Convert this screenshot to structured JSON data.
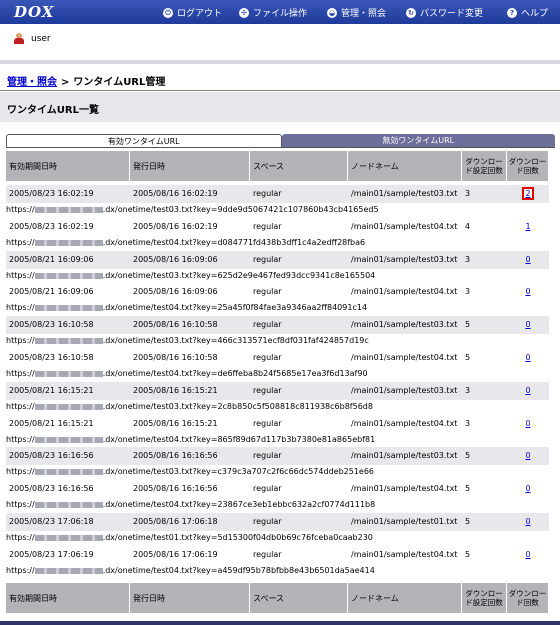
{
  "header": {
    "logo": "DOX",
    "nav": [
      {
        "label": "ログアウト",
        "icon": "logout-icon"
      },
      {
        "label": "ファイル操作",
        "icon": "file-operation-icon"
      },
      {
        "label": "管理・照会",
        "icon": "admin-icon"
      },
      {
        "label": "パスワード変更",
        "icon": "password-change-icon"
      },
      {
        "label": "ヘルプ",
        "icon": "help-icon"
      }
    ]
  },
  "user": {
    "name": "user"
  },
  "breadcrumb": {
    "parent": "管理・照会",
    "separator": ">",
    "current": "ワンタイムURL管理"
  },
  "section_title": "ワンタイムURL一覧",
  "tabs": [
    {
      "label": "有効ワンタイムURL",
      "active": true
    },
    {
      "label": "無効ワンタイムURL",
      "active": false
    }
  ],
  "columns": {
    "expiry": "有効期間日時",
    "issued": "発行日時",
    "space": "スペース",
    "node": "ノードネーム",
    "dl_limit": "ダウンロード設定回数",
    "dl_count": "ダウンロード回数"
  },
  "rows": [
    {
      "expiry": "2005/08/23 16:02:19",
      "issued": "2005/08/16 16:02:19",
      "space": "regular",
      "node": "/main01/sample/test03.txt",
      "limit": "3",
      "count": "2",
      "url_prefix": "https://",
      "url_suffix": ".dx/onetime/test03.txt?key=9dde9d5067421c107860b43cb4165ed5",
      "highlight": true
    },
    {
      "expiry": "2005/08/23 16:02:19",
      "issued": "2005/08/16 16:02:19",
      "space": "regular",
      "node": "/main01/sample/test04.txt",
      "limit": "4",
      "count": "1",
      "url_prefix": "https://",
      "url_suffix": ".dx/onetime/test04.txt?key=d084771fd438b3dff1c4a2edff28fba6"
    },
    {
      "expiry": "2005/08/21 16:09:06",
      "issued": "2005/08/16 16:09:06",
      "space": "regular",
      "node": "/main01/sample/test03.txt",
      "limit": "3",
      "count": "0",
      "url_prefix": "https://",
      "url_suffix": ".dx/onetime/test03.txt?key=625d2e9e467fed93dcc9341c8e165504"
    },
    {
      "expiry": "2005/08/21 16:09:06",
      "issued": "2005/08/16 16:09:06",
      "space": "regular",
      "node": "/main01/sample/test04.txt",
      "limit": "3",
      "count": "0",
      "url_prefix": "https://",
      "url_suffix": ".dx/onetime/test04.txt?key=25a45f0f84fae3a9346aa2ff84091c14"
    },
    {
      "expiry": "2005/08/23 16:10:58",
      "issued": "2005/08/16 16:10:58",
      "space": "regular",
      "node": "/main01/sample/test03.txt",
      "limit": "5",
      "count": "0",
      "url_prefix": "https://",
      "url_suffix": ".dx/onetime/test03.txt?key=466c313571ecf8df031faf424857d19c"
    },
    {
      "expiry": "2005/08/23 16:10:58",
      "issued": "2005/08/16 16:10:58",
      "space": "regular",
      "node": "/main01/sample/test04.txt",
      "limit": "5",
      "count": "0",
      "url_prefix": "https://",
      "url_suffix": ".dx/onetime/test04.txt?key=de6ffeba8b24f5685e17ea3f6d13af90"
    },
    {
      "expiry": "2005/08/21 16:15:21",
      "issued": "2005/08/16 16:15:21",
      "space": "regular",
      "node": "/main01/sample/test03.txt",
      "limit": "3",
      "count": "0",
      "url_prefix": "https://",
      "url_suffix": ".dx/onetime/test03.txt?key=2c8b850c5f508818c811938c6b8f56d8"
    },
    {
      "expiry": "2005/08/21 16:15:21",
      "issued": "2005/08/16 16:15:21",
      "space": "regular",
      "node": "/main01/sample/test04.txt",
      "limit": "3",
      "count": "0",
      "url_prefix": "https://",
      "url_suffix": ".dx/onetime/test04.txt?key=865f89d67d117b3b7380e81a865ebf81"
    },
    {
      "expiry": "2005/08/23 16:16:56",
      "issued": "2005/08/16 16:16:56",
      "space": "regular",
      "node": "/main01/sample/test03.txt",
      "limit": "5",
      "count": "0",
      "url_prefix": "https://",
      "url_suffix": ".dx/onetime/test03.txt?key=c379c3a707c2f6c66dc574ddeb251e66"
    },
    {
      "expiry": "2005/08/23 16:16:56",
      "issued": "2005/08/16 16:16:56",
      "space": "regular",
      "node": "/main01/sample/test04.txt",
      "limit": "5",
      "count": "0",
      "url_prefix": "https://",
      "url_suffix": ".dx/onetime/test04.txt?key=23867ce3eb1ebbc632a2cf0774d111b8"
    },
    {
      "expiry": "2005/08/23 17:06:18",
      "issued": "2005/08/16 17:06:18",
      "space": "regular",
      "node": "/main01/sample/test01.txt",
      "limit": "5",
      "count": "0",
      "url_prefix": "https://",
      "url_suffix": ".dx/onetime/test01.txt?key=5d15300f04db0b69c76fceba0caab230"
    },
    {
      "expiry": "2005/08/23 17:06:19",
      "issued": "2005/08/16 17:06:19",
      "space": "regular",
      "node": "/main01/sample/test04.txt",
      "limit": "5",
      "count": "0",
      "url_prefix": "https://",
      "url_suffix": ".dx/onetime/test04.txt?key=a459df95b78bfbb8e43b6501da5ae414"
    }
  ]
}
